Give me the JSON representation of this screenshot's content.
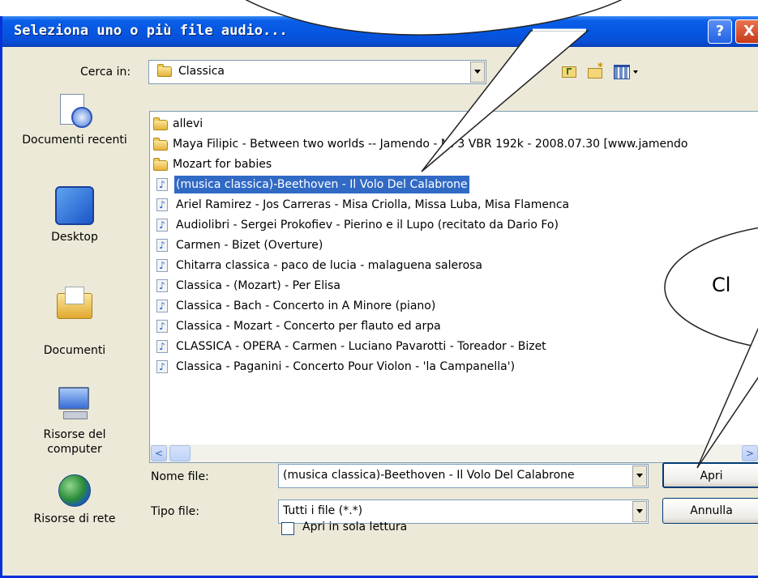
{
  "window": {
    "title": "Seleziona uno o più file audio...",
    "help_glyph": "?",
    "close_glyph": "X"
  },
  "look_in": {
    "label": "Cerca in:",
    "value": "Classica"
  },
  "places": [
    {
      "label": "Documenti recenti",
      "icon": "recent-documents-icon"
    },
    {
      "label": "Desktop",
      "icon": "desktop-icon"
    },
    {
      "label": "Documenti",
      "icon": "documents-icon"
    },
    {
      "label": "Risorse del computer",
      "icon": "my-computer-icon"
    },
    {
      "label": "Risorse di rete",
      "icon": "network-icon"
    }
  ],
  "files": [
    {
      "name": "allevi",
      "type": "folder"
    },
    {
      "name": "Maya Filipic - Between two worlds -- Jamendo - MP3 VBR 192k - 2008.07.30 [www.jamendo",
      "type": "folder"
    },
    {
      "name": "Mozart for babies",
      "type": "folder"
    },
    {
      "name": "(musica classica)-Beethoven - Il Volo Del Calabrone",
      "type": "audio",
      "selected": true
    },
    {
      "name": "Ariel Ramirez - Jos Carreras - Misa Criolla, Missa Luba, Misa Flamenca",
      "type": "audio"
    },
    {
      "name": "Audiolibri - Sergei Prokofiev - Pierino e il Lupo (recitato da Dario Fo)",
      "type": "audio"
    },
    {
      "name": "Carmen - Bizet (Overture)",
      "type": "audio"
    },
    {
      "name": "Chitarra classica - paco de lucia - malaguena salerosa",
      "type": "audio"
    },
    {
      "name": "Classica - (Mozart) - Per Elisa",
      "type": "audio"
    },
    {
      "name": "Classica - Bach - Concerto in A Minore (piano)",
      "type": "audio"
    },
    {
      "name": "Classica - Mozart - Concerto per flauto ed arpa",
      "type": "audio"
    },
    {
      "name": "CLASSICA - OPERA - Carmen - Luciano Pavarotti - Toreador - Bizet",
      "type": "audio"
    },
    {
      "name": "Classica - Paganini - Concerto Pour Violon - 'la Campanella')",
      "type": "audio"
    }
  ],
  "filename": {
    "label": "Nome file:",
    "value": "(musica classica)-Beethoven - Il Volo Del Calabrone"
  },
  "filetype": {
    "label": "Tipo file:",
    "value": "Tutti i file (*.*)"
  },
  "readonly": {
    "label": "Apri in sola lettura"
  },
  "buttons": {
    "open": "Apri",
    "cancel": "Annulla"
  },
  "callout": {
    "text": "Cl"
  },
  "scroll": {
    "left_glyph": "<",
    "right_glyph": ">"
  },
  "colors": {
    "selection": "#316ac5",
    "titlebar": "#0556e0",
    "dialog_bg": "#ece9d8"
  }
}
